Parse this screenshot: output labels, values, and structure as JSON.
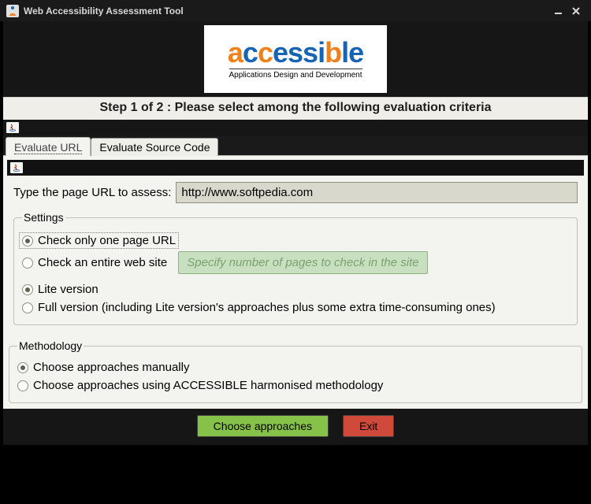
{
  "window": {
    "title": "Web Accessibility Assessment Tool"
  },
  "logo": {
    "word_a1": "a",
    "word_c1": "c",
    "word_c2": "c",
    "word_e": "e",
    "word_s1": "s",
    "word_s2": "s",
    "word_i": "i",
    "word_b": "b",
    "word_l": "l",
    "word_e2": "e",
    "tagline": "Applications Design and Development"
  },
  "step_text": "Step 1 of 2 : Please select among the following evaluation criteria",
  "tabs": {
    "evaluate_url": "Evaluate URL",
    "evaluate_source": "Evaluate Source Code"
  },
  "form": {
    "url_label": "Type the page URL to assess:",
    "url_value": "http://www.softpedia.com",
    "settings_legend": "Settings",
    "scope_one": "Check only one page URL",
    "scope_site": "Check an entire web site",
    "pages_placeholder": "Specify number of pages to check in the site",
    "ver_lite": "Lite version",
    "ver_full": "Full version (including Lite version's approaches plus some extra time-consuming ones)",
    "method_legend": "Methodology",
    "method_manual": "Choose approaches manually",
    "method_harmon": "Choose approaches using ACCESSIBLE harmonised methodology"
  },
  "buttons": {
    "choose": "Choose approaches",
    "exit": "Exit"
  },
  "colors": {
    "orange": "#f0801a",
    "blue": "#1864b4"
  }
}
